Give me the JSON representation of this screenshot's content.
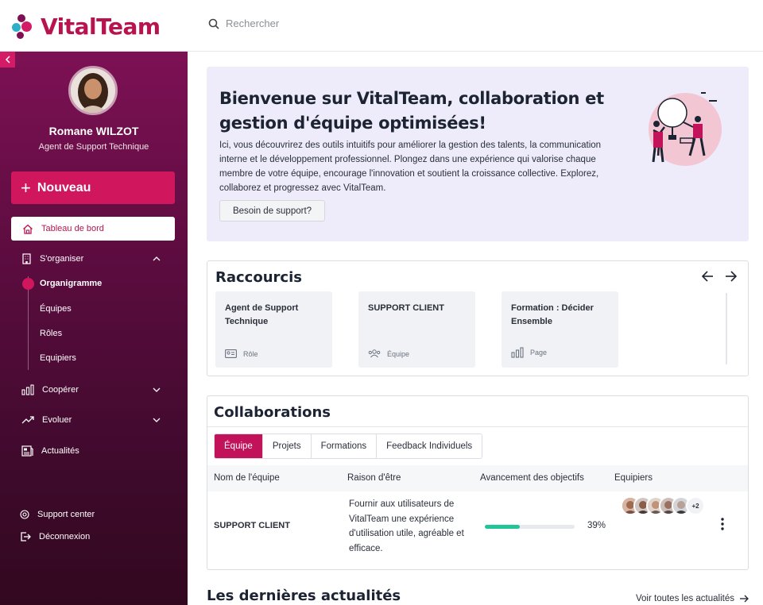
{
  "brand": {
    "name": "VitalTeam",
    "accent": "#b8134f"
  },
  "search": {
    "placeholder": "Rechercher",
    "icon": "search-icon"
  },
  "user": {
    "name": "Romane WILZOT",
    "role": "Agent de Support Technique"
  },
  "sidebar": {
    "new_button": "Nouveau",
    "active_item": "Tableau de bord",
    "organize": "S'organiser",
    "sub_items": [
      "Organigramme",
      "Équipes",
      "Rôles",
      "Equipiers"
    ],
    "cooperate": "Coopérer",
    "evolve": "Evoluer",
    "news": "Actualités",
    "support": "Support center",
    "logout": "Déconnexion"
  },
  "hero": {
    "title": "Bienvenue sur VitalTeam, collaboration et gestion d'équipe optimisées!",
    "description": "Ici, vous découvrirez des outils intuitifs pour améliorer la gestion des talents, la communication interne et le développement professionnel. Plongez dans une expérience qui valorise chaque membre de votre équipe, encourage l'innovation et soutient la croissance collective. Explorez, collaborez et progressez avec VitalTeam.",
    "support_button": "Besoin de support?"
  },
  "shortcuts": {
    "title": "Raccourcis",
    "items": [
      {
        "title": "Agent de Support Technique",
        "type": "Rôle",
        "icon": "id-card-icon"
      },
      {
        "title": "SUPPORT CLIENT",
        "type": "Équipe",
        "icon": "team-icon"
      },
      {
        "title": "Formation : Décider Ensemble",
        "type": "Page",
        "icon": "chart-icon"
      }
    ]
  },
  "collaborations": {
    "title": "Collaborations",
    "tabs": [
      "Équipe",
      "Projets",
      "Formations",
      "Feedback Individuels"
    ],
    "active_tab": 0,
    "columns": [
      "Nom de l'équipe",
      "Raison d'être",
      "Avancement des objectifs",
      "Equipiers"
    ],
    "rows": [
      {
        "team": "SUPPORT CLIENT",
        "purpose": "Fournir aux utilisateurs de VitalTeam une expérience d'utilisation utile, agréable et efficace.",
        "progress_label": "39%",
        "progress": 0.39,
        "extra_members": "+2"
      }
    ]
  },
  "news": {
    "title": "Les dernières actualités",
    "link": "Voir toutes les actualités"
  }
}
